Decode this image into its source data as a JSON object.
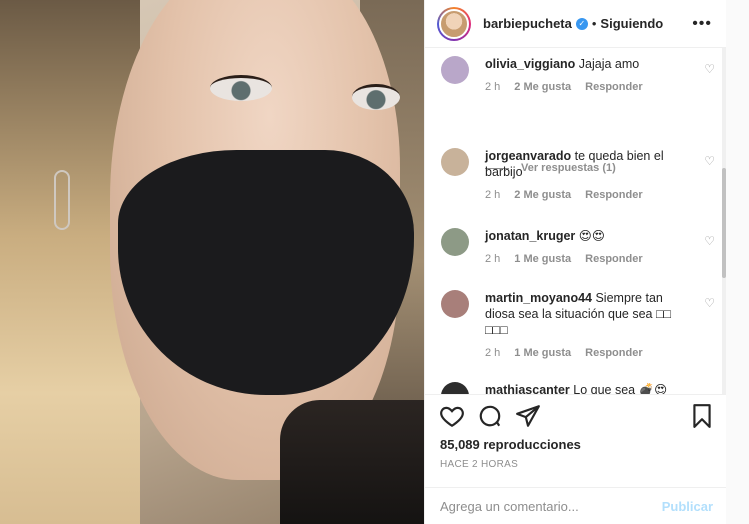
{
  "post": {
    "username": "barbiepucheta",
    "separator": "•",
    "following_label": "Siguiendo",
    "more_icon": "more-options-icon"
  },
  "comments": [
    {
      "user": "olivia_viggiano",
      "text": "Jajaja amo",
      "time": "2 h",
      "likes": "2 Me gusta",
      "reply": "Responder",
      "avatar_color": "#b9a7c9"
    },
    {
      "user": "jorgeanvarado",
      "text": "te queda bien el barbijo",
      "time": "2 h",
      "likes": "2 Me gusta",
      "reply": "Responder",
      "avatar_color": "#c8b29a"
    },
    {
      "user": "jonatan_kruger",
      "text": "😍😍",
      "time": "2 h",
      "likes": "1 Me gusta",
      "reply": "Responder",
      "avatar_color": "#8d9a86"
    },
    {
      "user": "martin_moyano44",
      "text": "Siempre tan diosa sea la situación que sea □□ □□□",
      "time": "2 h",
      "likes": "1 Me gusta",
      "reply": "Responder",
      "avatar_color": "#a87f7a"
    },
    {
      "user": "mathiascanter",
      "text": "Lo que sea 💣😍",
      "time": "",
      "likes": "",
      "reply": "",
      "avatar_color": "#2d2d2d"
    }
  ],
  "view_replies": "Ver respuestas (1)",
  "stats": {
    "views": "85,089 reproducciones",
    "time_ago": "HACE 2 HORAS"
  },
  "comment_box": {
    "placeholder": "Agrega un comentario...",
    "publish": "Publicar"
  },
  "colors": {
    "accent_blue": "#3897f0",
    "publish_disabled": "#b2dffc",
    "muted": "#8e8e8e"
  }
}
